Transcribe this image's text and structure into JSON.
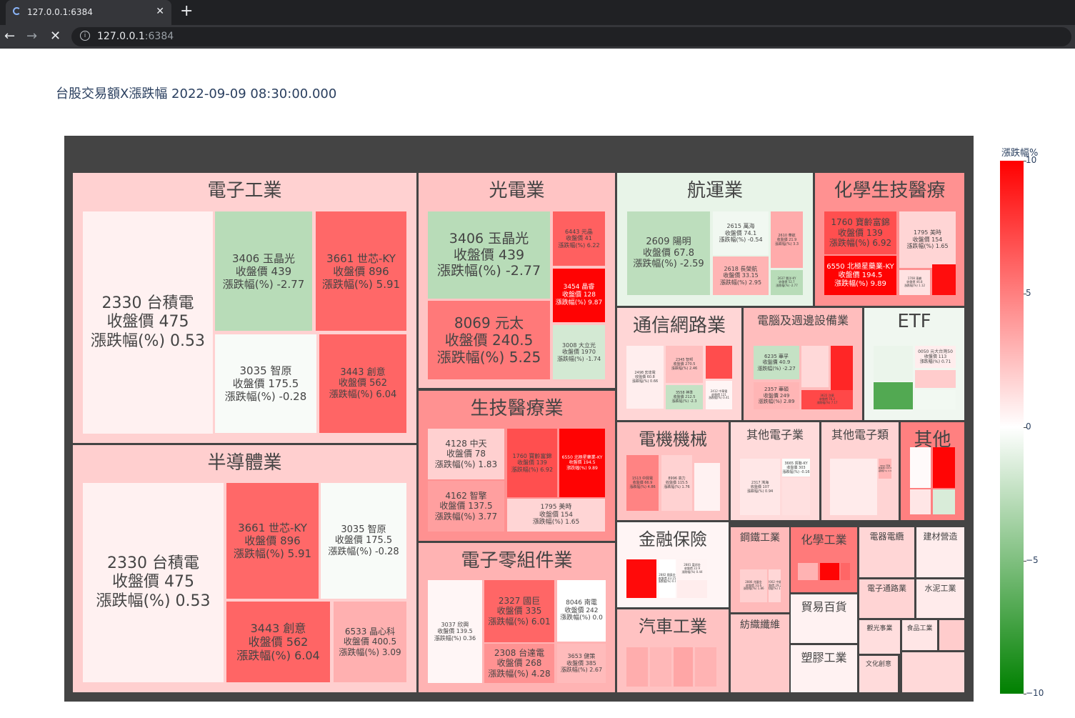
{
  "browser": {
    "tab_title": "127.0.0.1:6384",
    "close_glyph": "✕",
    "new_tab_glyph": "+",
    "back_glyph": "←",
    "forward_glyph": "→",
    "stop_glyph": "✕",
    "info_glyph": "i",
    "url_host": "127.0.0.1",
    "url_port": ":6384"
  },
  "page": {
    "title": "台股交易額X漲跌幅 2022-09-09 08:30:00.000"
  },
  "colorbar": {
    "title": "漲跌幅%",
    "ticks": [
      "10",
      "5",
      "0",
      "−5",
      "−10"
    ],
    "range": [
      -10,
      10
    ],
    "colors": {
      "max": "#ff0000",
      "mid": "#ffffff",
      "min": "#008000"
    }
  },
  "sectors": [
    {
      "label": "電子工業",
      "change": 1.8
    },
    {
      "label": "半導體業",
      "change": 1.9
    },
    {
      "label": "光電業",
      "change": 2.3
    },
    {
      "label": "生技醫療業",
      "change": 4.3
    },
    {
      "label": "電子零組件業",
      "change": 3.0
    },
    {
      "label": "航運業",
      "change": -0.9
    },
    {
      "label": "化學生技醫療",
      "change": 4.3
    },
    {
      "label": "通信網路業",
      "change": 1.6
    },
    {
      "label": "電腦及週邊設備業",
      "change": 2.6
    },
    {
      "label": "ETF",
      "change": -0.6
    },
    {
      "label": "電機機械",
      "change": 2.4
    },
    {
      "label": "其他電子業",
      "change": 1.4
    },
    {
      "label": "其他電子類",
      "change": 1.7
    },
    {
      "label": "其他",
      "change": 5.0
    },
    {
      "label": "金融保險",
      "change": 0.4
    },
    {
      "label": "鋼鐵工業",
      "change": 2.7
    },
    {
      "label": "化學工業",
      "change": 5.2
    },
    {
      "label": "電器電纜",
      "change": 1.6
    },
    {
      "label": "建材營造",
      "change": 0.7
    },
    {
      "label": "汽車工業",
      "change": 2.4
    },
    {
      "label": "紡織纖維",
      "change": 2.1
    },
    {
      "label": "貿易百貨",
      "change": 0.5
    },
    {
      "label": "電子通路業",
      "change": 1.7
    },
    {
      "label": "水泥工業",
      "change": 0.8
    },
    {
      "label": "塑膠工業",
      "change": 0.5
    },
    {
      "label": "觀光事業",
      "change": 1.3
    },
    {
      "label": "食品工業",
      "change": 1.0
    },
    {
      "label": "文化創意",
      "change": 1.4
    },
    {
      "label": "",
      "change": 2.0
    },
    {
      "label": "",
      "change": 1.5
    }
  ],
  "tiles": [
    {
      "name": "2330 台積電",
      "price": "收盤價 475",
      "change": "漲跌幅(%) 0.53",
      "value": 0.53
    },
    {
      "name": "3406 玉晶光",
      "price": "收盤價 439",
      "change": "漲跌幅(%) -2.77",
      "value": -2.77
    },
    {
      "name": "3661 世芯-KY",
      "price": "收盤價 896",
      "change": "漲跌幅(%) 5.91",
      "value": 5.91
    },
    {
      "name": "3035 智原",
      "price": "收盤價 175.5",
      "change": "漲跌幅(%) -0.28",
      "value": -0.28
    },
    {
      "name": "3443 創意",
      "price": "收盤價 562",
      "change": "漲跌幅(%) 6.04",
      "value": 6.04
    },
    {
      "name": "2330 台積電",
      "price": "收盤價 475",
      "change": "漲跌幅(%) 0.53",
      "value": 0.53
    },
    {
      "name": "3661 世芯-KY",
      "price": "收盤價 896",
      "change": "漲跌幅(%) 5.91",
      "value": 5.91
    },
    {
      "name": "3035 智原",
      "price": "收盤價 175.5",
      "change": "漲跌幅(%) -0.28",
      "value": -0.28
    },
    {
      "name": "3443 創意",
      "price": "收盤價 562",
      "change": "漲跌幅(%) 6.04",
      "value": 6.04
    },
    {
      "name": "6533 晶心科",
      "price": "收盤價 400.5",
      "change": "漲跌幅(%) 3.09",
      "value": 3.09
    },
    {
      "name": "3406 玉晶光",
      "price": "收盤價 439",
      "change": "漲跌幅(%) -2.77",
      "value": -2.77
    },
    {
      "name": "6443 元晶",
      "price": "收盤價 41",
      "change": "漲跌幅(%) 6.22",
      "value": 6.22
    },
    {
      "name": "3454 晶睿",
      "price": "收盤價 128",
      "change": "漲跌幅(%) 9.87",
      "value": 9.87
    },
    {
      "name": "8069 元太",
      "price": "收盤價 240.5",
      "change": "漲跌幅(%) 5.25",
      "value": 5.25
    },
    {
      "name": "3008 大立光",
      "price": "收盤價 1970",
      "change": "漲跌幅(%) -1.74",
      "value": -1.74
    },
    {
      "name": "4128 中天",
      "price": "收盤價 78",
      "change": "漲跌幅(%) 1.83",
      "value": 1.83
    },
    {
      "name": "1760 寶齡富錦",
      "price": "收盤價 139",
      "change": "漲跌幅(%) 6.92",
      "value": 6.92
    },
    {
      "name": "6550 北極星藥業-KY",
      "price": "收盤價 194.5",
      "change": "漲跌幅(%) 9.89",
      "value": 9.89
    },
    {
      "name": "4162 智擎",
      "price": "收盤價 137.5",
      "change": "漲跌幅(%) 3.77",
      "value": 3.77
    },
    {
      "name": "1795 美時",
      "price": "收盤價 154",
      "change": "漲跌幅(%) 1.65",
      "value": 1.65
    },
    {
      "name": "3037 欣興",
      "price": "收盤價 139.5",
      "change": "漲跌幅(%) 0.36",
      "value": 0.36
    },
    {
      "name": "2327 國巨",
      "price": "收盤價 335",
      "change": "漲跌幅(%) 6.01",
      "value": 6.01
    },
    {
      "name": "8046 南電",
      "price": "收盤價 242",
      "change": "漲跌幅(%) 0.0",
      "value": 0.0
    },
    {
      "name": "2308 台達電",
      "price": "收盤價 268",
      "change": "漲跌幅(%) 4.28",
      "value": 4.28
    },
    {
      "name": "3653 健策",
      "price": "收盤價 385",
      "change": "漲跌幅(%) 2.67",
      "value": 2.67
    },
    {
      "name": "2609 陽明",
      "price": "收盤價 67.8",
      "change": "漲跌幅(%) -2.59",
      "value": -2.59
    },
    {
      "name": "2615 萬海",
      "price": "收盤價 74.1",
      "change": "漲跌幅(%) -0.54",
      "value": -0.54
    },
    {
      "name": "2618 長榮航",
      "price": "收盤價 33.15",
      "change": "漲跌幅(%) 2.95",
      "value": 2.95
    },
    {
      "name": "2610 華航",
      "price": "收盤價 21.9",
      "change": "漲跌幅(%) 3.3",
      "value": 3.3
    },
    {
      "name": "2637 慧洋-KY",
      "price": "收盤價 52.7",
      "change": "漲跌幅(%) -2.77",
      "value": -2.77
    },
    {
      "name": "1760 寶齡富錦",
      "price": "收盤價 139",
      "change": "漲跌幅(%) 6.92",
      "value": 6.92
    },
    {
      "name": "1795 美時",
      "price": "收盤價 154",
      "change": "漲跌幅(%) 1.65",
      "value": 1.65
    },
    {
      "name": "6550 北極星藥業-KY",
      "price": "收盤價 194.5",
      "change": "漲跌幅(%) 9.89",
      "value": 9.89
    },
    {
      "name": "1708 東鹼",
      "price": "收盤價 46.8",
      "change": "漲跌幅(%) 1.12",
      "value": 1.12
    },
    {
      "name": "",
      "price": "",
      "change": "",
      "value": 9.5
    },
    {
      "name": "2498 宏達電",
      "price": "收盤價 60.8",
      "change": "漲跌幅(%) 0.66",
      "value": 0.66
    },
    {
      "name": "2345 智邦",
      "price": "收盤價 270.5",
      "change": "漲跌幅(%) 2.46",
      "value": 2.46
    },
    {
      "name": "",
      "price": "",
      "change": "",
      "value": 7.0
    },
    {
      "name": "3558 神準",
      "price": "收盤價 212.5",
      "change": "漲跌幅(%) -2.3",
      "value": -2.3
    },
    {
      "name": "2412 中華電",
      "price": "收盤價 121",
      "change": "漲跌幅(%) 0.41",
      "value": 0.41
    },
    {
      "name": "6235 華孚",
      "price": "收盤價 40.9",
      "change": "漲跌幅(%) -2.27",
      "value": -2.27
    },
    {
      "name": "",
      "price": "",
      "change": "",
      "value": 1.5
    },
    {
      "name": "",
      "price": "",
      "change": "",
      "value": 8.5
    },
    {
      "name": "2357 華碩",
      "price": "收盤價 249",
      "change": "漲跌幅(%) 2.89",
      "value": 2.89
    },
    {
      "name": "3622 洋華",
      "price": "收盤價 76.2",
      "change": "漲跌幅(%) 7.17",
      "value": 7.17
    },
    {
      "name": "",
      "price": "",
      "change": "",
      "value": -0.8
    },
    {
      "name": "0050 元大台灣50",
      "price": "收盤價 113",
      "change": "漲跌幅(%) 0.71",
      "value": 0.71
    },
    {
      "name": "",
      "price": "",
      "change": "",
      "value": -6.8
    },
    {
      "name": "",
      "price": "",
      "change": "",
      "value": 2.0
    },
    {
      "name": "",
      "price": "",
      "change": "",
      "value": -0.5
    },
    {
      "name": "1513 中興電",
      "price": "收盤價 66.9",
      "change": "漲跌幅(%) 4.86",
      "value": 4.86
    },
    {
      "name": "8996 高力",
      "price": "收盤價 115.5",
      "change": "漲跌幅(%) 1.76",
      "value": 1.76
    },
    {
      "name": "",
      "price": "",
      "change": "",
      "value": 0.5
    },
    {
      "name": "2317 鴻海",
      "price": "收盤價 107",
      "change": "漲跌幅(%) 0.94",
      "value": 0.94
    },
    {
      "name": "3665 貿聯-KY",
      "price": "收盤價 303",
      "change": "漲跌幅(%) -0.16",
      "value": -0.16
    },
    {
      "name": "",
      "price": "",
      "change": "",
      "value": 1.2
    },
    {
      "name": "",
      "price": "",
      "change": "",
      "value": 0.8
    },
    {
      "name": "3552 同致",
      "price": "收盤價 191.5",
      "change": "漲跌幅(%) 2.96",
      "value": 2.96
    },
    {
      "name": "",
      "price": "",
      "change": "",
      "value": 0.2
    },
    {
      "name": "",
      "price": "",
      "change": "",
      "value": 9.8
    },
    {
      "name": "",
      "price": "",
      "change": "",
      "value": 1.0
    },
    {
      "name": "",
      "price": "",
      "change": "",
      "value": -1.5
    },
    {
      "name": "",
      "price": "",
      "change": "",
      "value": 9.6
    },
    {
      "name": "2882 國泰金",
      "price": "收盤價 43.15",
      "change": "漲跌幅(%) 0.0",
      "value": 0.0
    },
    {
      "name": "2881 富邦金",
      "price": "收盤價 22.9",
      "change": "漲跌幅(%) 0.44",
      "value": 0.44
    },
    {
      "name": "",
      "price": "",
      "change": "",
      "value": 0.7
    },
    {
      "name": "2886 兆豐金",
      "price": "收盤價 33.6",
      "change": "漲跌幅(%) 1.86",
      "value": 1.86
    },
    {
      "name": "2002 中鋼",
      "price": "收盤價 29.25",
      "change": "漲跌幅(%) 1.56",
      "value": 1.56
    },
    {
      "name": "",
      "price": "",
      "change": "",
      "value": 3.0
    },
    {
      "name": "",
      "price": "",
      "change": "",
      "value": 9.8
    },
    {
      "name": "",
      "price": "",
      "change": "",
      "value": 6.0
    },
    {
      "name": "",
      "price": "",
      "change": "",
      "value": 3.2
    },
    {
      "name": "",
      "price": "",
      "change": "",
      "value": 2.8
    },
    {
      "name": "",
      "price": "",
      "change": "",
      "value": 3.5
    },
    {
      "name": "",
      "price": "",
      "change": "",
      "value": 3.0
    },
    {
      "name": "",
      "price": "",
      "change": "",
      "value": 2.4
    }
  ]
}
